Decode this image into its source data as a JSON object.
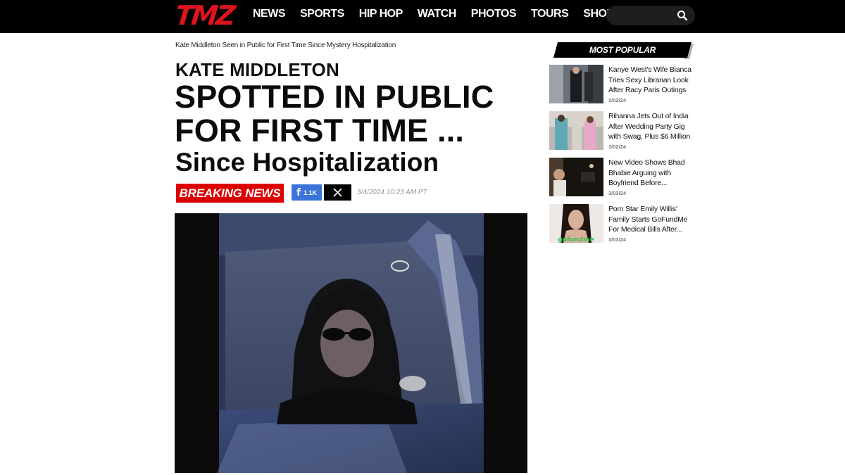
{
  "header": {
    "logo": "TMZ",
    "nav": [
      "NEWS",
      "SPORTS",
      "HIP HOP",
      "WATCH",
      "PHOTOS",
      "TOURS",
      "SHOP"
    ],
    "search_placeholder": ""
  },
  "article": {
    "breadcrumb": "Kate Middleton Seen in Public for First Time Since Mystery Hospitalization",
    "kicker": "KATE MIDDLETON",
    "headline_line1": "SPOTTED IN PUBLIC",
    "headline_line2": "FOR FIRST TIME ...",
    "subhead": "Since Hospitalization",
    "breaking_label": "BREAKING NEWS",
    "facebook_count": "1.1K",
    "date": "3/4/2024 10:23 AM PT",
    "photo_alt": "Woman with sunglasses in the back seat of a car"
  },
  "sidebar": {
    "title": "MOST POPULAR",
    "items": [
      {
        "title": "Kanye West's Wife Bianca Tries Sexy Librarian Look After Racy Paris Outings",
        "date": "3/02/24"
      },
      {
        "title": "Rihanna Jets Out of India After Wedding Party Gig with Swag, Plus $6 Million",
        "date": "3/02/24"
      },
      {
        "title": "New Video Shows Bhad Bhabie Arguing with Boyfriend Before...",
        "date": "3/03/24"
      },
      {
        "title": "Porn Star Emily Willis' Family Starts GoFundMe For Medical Bills After...",
        "date": "3/03/24",
        "thumb_text": "gofundme"
      }
    ]
  },
  "colors": {
    "brand_red": "#e0141e",
    "breaking_red": "#dd0000",
    "facebook_blue": "#3b74d8"
  }
}
